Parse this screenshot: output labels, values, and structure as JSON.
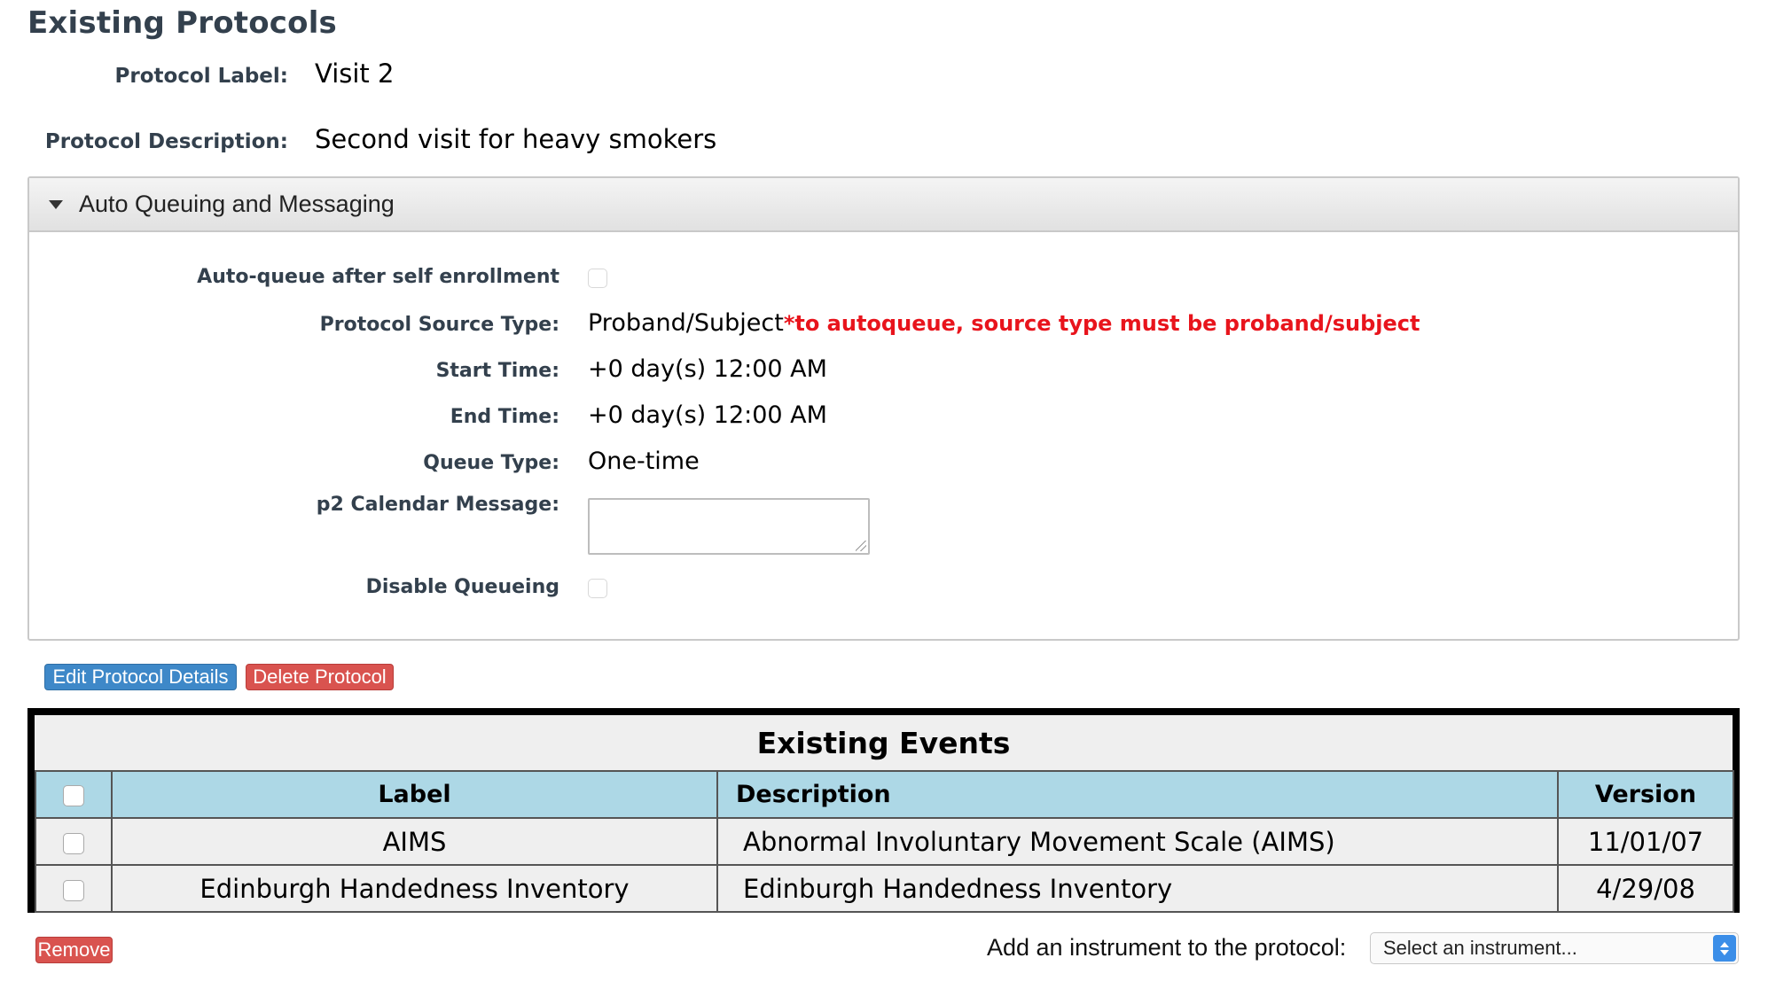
{
  "page": {
    "title": "Existing Protocols"
  },
  "protocol": {
    "label_caption": "Protocol Label:",
    "label_value": "Visit 2",
    "description_caption": "Protocol Description:",
    "description_value": "Second visit for heavy smokers"
  },
  "auto_queue_panel": {
    "title": "Auto Queuing and Messaging",
    "auto_queue_label": "Auto-queue after self enrollment",
    "auto_queue_checked": false,
    "source_type_label": "Protocol Source Type:",
    "source_type_value": "Proband/Subject",
    "source_type_warning": "*to autoqueue, source type must be proband/subject",
    "start_time_label": "Start Time:",
    "start_time_value": "+0 day(s) 12:00 AM",
    "end_time_label": "End Time:",
    "end_time_value": "+0 day(s) 12:00 AM",
    "queue_type_label": "Queue Type:",
    "queue_type_value": "One-time",
    "calendar_message_label": "p2 Calendar Message:",
    "calendar_message_value": "",
    "disable_queueing_label": "Disable Queueing",
    "disable_queueing_checked": false
  },
  "actions": {
    "edit_label": "Edit Protocol Details",
    "delete_label": "Delete Protocol"
  },
  "events": {
    "title": "Existing Events",
    "columns": {
      "label": "Label",
      "description": "Description",
      "version": "Version"
    },
    "rows": [
      {
        "label": "AIMS",
        "description": "Abnormal Involuntary Movement Scale (AIMS)",
        "version": "11/01/07"
      },
      {
        "label": "Edinburgh Handedness Inventory",
        "description": "Edinburgh Handedness Inventory",
        "version": "4/29/08"
      }
    ]
  },
  "footer": {
    "remove_label": "Remove",
    "add_instrument_label": "Add an instrument to the protocol:",
    "select_placeholder": "Select an instrument..."
  },
  "colors": {
    "header_text": "#33404d",
    "warning": "#e8141c",
    "primary_button": "#3e88c8",
    "danger_button": "#d9534f",
    "table_header": "#add8e6"
  }
}
